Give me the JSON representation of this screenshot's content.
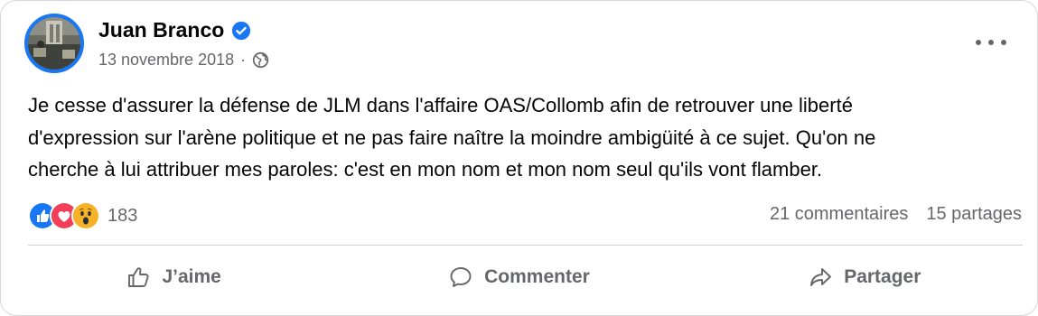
{
  "post": {
    "author": "Juan Branco",
    "date": "13 novembre 2018",
    "separator": "·",
    "audience_icon": "globe-icon",
    "verified_icon": "verified-badge-icon",
    "body_lines": [
      "Je cesse d'assurer la défense de JLM dans l'affaire OAS/Collomb afin de retrouver une liberté",
      "d'expression sur l'arène politique et ne pas faire naître la moindre ambigüité à ce sujet. Qu'on ne",
      "cherche à lui attribuer mes paroles: c'est en mon nom et mon nom seul qu'ils vont flamber."
    ],
    "reactions": {
      "types": [
        "like-icon",
        "love-icon",
        "wow-icon"
      ],
      "count": "183"
    },
    "comments": "21 commentaires",
    "shares": "15 partages",
    "actions": {
      "like": "J’aime",
      "comment": "Commenter",
      "share": "Partager"
    },
    "colors": {
      "accent": "#1877f2",
      "love": "#f33e58",
      "wow": "#f7b125",
      "muted_text": "#65676b"
    }
  }
}
